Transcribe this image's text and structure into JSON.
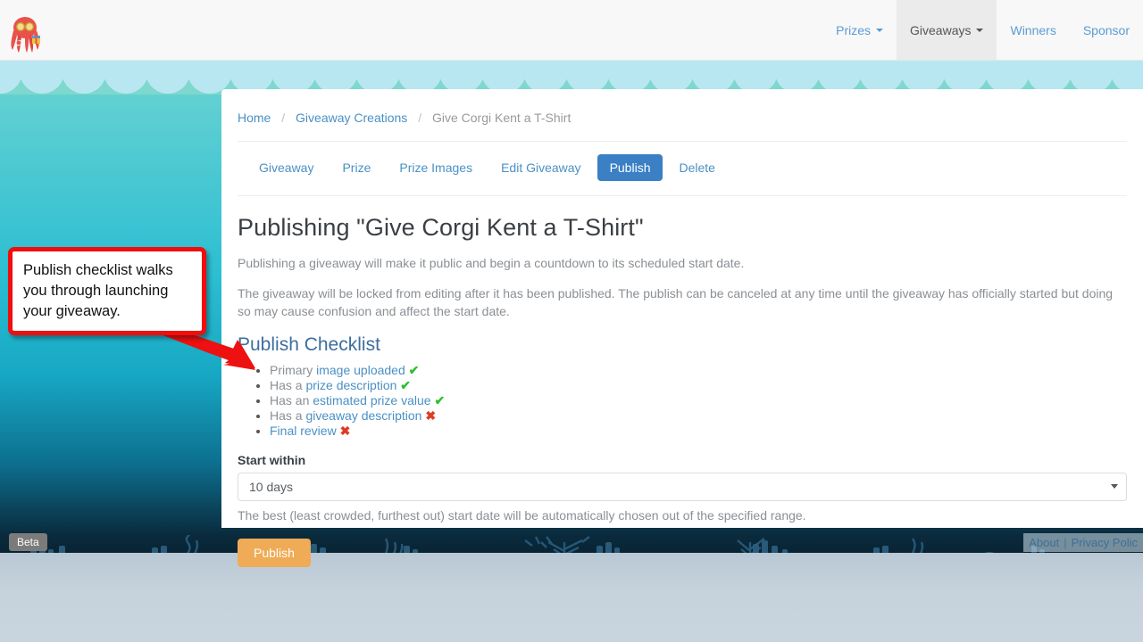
{
  "navbar": {
    "logo_icon": "octopus-logo-icon",
    "items": [
      {
        "label": "Prizes",
        "has_caret": true,
        "active": false
      },
      {
        "label": "Giveaways",
        "has_caret": true,
        "active": true
      },
      {
        "label": "Winners",
        "has_caret": false,
        "active": false
      },
      {
        "label": "Sponsor",
        "has_caret": false,
        "active": false
      }
    ]
  },
  "breadcrumb": {
    "home": "Home",
    "creations": "Giveaway Creations",
    "current": "Give Corgi Kent a T-Shirt",
    "separator": "/"
  },
  "tabs": [
    {
      "label": "Giveaway",
      "active": false
    },
    {
      "label": "Prize",
      "active": false
    },
    {
      "label": "Prize Images",
      "active": false
    },
    {
      "label": "Edit Giveaway",
      "active": false
    },
    {
      "label": "Publish",
      "active": true
    },
    {
      "label": "Delete",
      "active": false
    }
  ],
  "main": {
    "title": "Publishing \"Give Corgi Kent a T-Shirt\"",
    "paragraph1": "Publishing a giveaway will make it public and begin a countdown to its scheduled start date.",
    "paragraph2": "The giveaway will be locked from editing after it has been published. The publish can be canceled at any time until the giveaway has officially started but doing so may cause confusion and affect the start date.",
    "checklist_title": "Publish Checklist",
    "checklist": [
      {
        "prefix": "Primary ",
        "link": "image uploaded",
        "status": "ok",
        "mark": "✔"
      },
      {
        "prefix": "Has a ",
        "link": "prize description",
        "status": "ok",
        "mark": "✔"
      },
      {
        "prefix": "Has an ",
        "link": "estimated prize value",
        "status": "ok",
        "mark": "✔"
      },
      {
        "prefix": "Has a ",
        "link": "giveaway description",
        "status": "no",
        "mark": "✖"
      },
      {
        "prefix": "",
        "link": "Final review",
        "status": "no",
        "mark": "✖"
      }
    ],
    "start_within_label": "Start within",
    "start_within_value": "10 days",
    "start_within_options": [
      "10 days"
    ],
    "help_text": "The best (least crowded, furthest out) start date will be automatically chosen out of the specified range.",
    "publish_button": "Publish"
  },
  "footer": {
    "about": "About",
    "divider": "|",
    "privacy": "Privacy Polic"
  },
  "beta_badge": "Beta",
  "annotation": {
    "text": "Publish checklist walks you through launching your giveaway.",
    "border_color": "#f20d0d",
    "arrow_color": "#ee1111"
  },
  "colors": {
    "accent_blue": "#3b7fc4",
    "link_blue": "#4a90c4",
    "publish_orange": "#efab56",
    "check_green": "#2fbf2f",
    "cross_red": "#e03b22",
    "ocean_top": "#7ed8cd",
    "ocean_bottom": "#071d2a"
  }
}
